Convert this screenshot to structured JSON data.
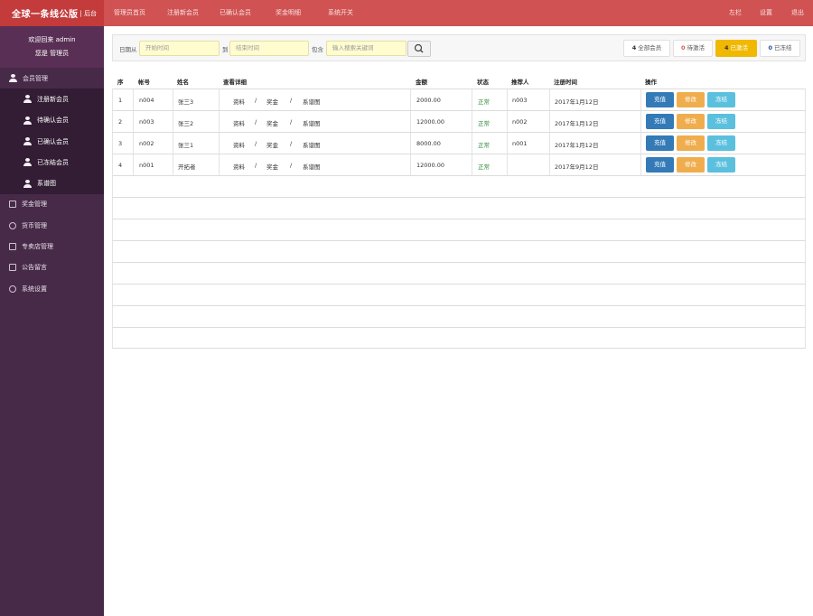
{
  "brand": {
    "title": "全球一条线公版",
    "sub": "| 后台"
  },
  "top_nav": [
    "管理员首页",
    "注册新会员",
    "已确认会员",
    "奖金明细",
    "系统开关"
  ],
  "top_right": [
    "左栏",
    "设置",
    "退出"
  ],
  "sidebar": {
    "welcome": "欢迎回来 admin",
    "role": "您是 管理员",
    "member_group": "会员管理",
    "member_items": [
      "注册新会员",
      "待确认会员",
      "已确认会员",
      "已冻结会员",
      "系谱图"
    ],
    "groups": [
      "奖金管理",
      "货币管理",
      "专卖店管理",
      "公告留言",
      "系统设置"
    ]
  },
  "filter": {
    "date_from_label": "日期从",
    "date_from_placeholder": "开始时间",
    "to_label": "到",
    "date_to_placeholder": "结束时间",
    "contains_label": "包含",
    "keyword_placeholder": "输入搜索关键词"
  },
  "stats": [
    {
      "count": "4",
      "label": "全部会员",
      "color": "#333333",
      "bg": "#ffffff"
    },
    {
      "count": "0",
      "label": "待激活",
      "color": "#d9534f",
      "bg": "#ffffff"
    },
    {
      "count": "4",
      "label": "已激活",
      "color": "#ffffff",
      "bg": "#f0b800"
    },
    {
      "count": "0",
      "label": "已冻结",
      "color": "#1f4fa0",
      "bg": "#ffffff"
    }
  ],
  "table": {
    "headers": [
      "序",
      "帐号",
      "姓名",
      "查看详细",
      "金额",
      "状态",
      "推荐人",
      "注册时间",
      "操作"
    ],
    "detail_links": [
      "资料",
      "/",
      "奖金",
      "/",
      "系谱图"
    ],
    "actions": [
      "充值",
      "修改",
      "冻结"
    ],
    "rows": [
      {
        "no": "1",
        "account": "n004",
        "name": "张三3",
        "amount": "2000.00",
        "status": "正常",
        "referrer": "n003",
        "date": "2017年1月12日"
      },
      {
        "no": "2",
        "account": "n003",
        "name": "张三2",
        "amount": "12000.00",
        "status": "正常",
        "referrer": "n002",
        "date": "2017年1月12日"
      },
      {
        "no": "3",
        "account": "n002",
        "name": "张三1",
        "amount": "8000.00",
        "status": "正常",
        "referrer": "n001",
        "date": "2017年1月12日"
      },
      {
        "no": "4",
        "account": "n001",
        "name": "开拓者",
        "amount": "12000.00",
        "status": "正常",
        "referrer": "",
        "date": "2017年9月12日"
      }
    ]
  }
}
